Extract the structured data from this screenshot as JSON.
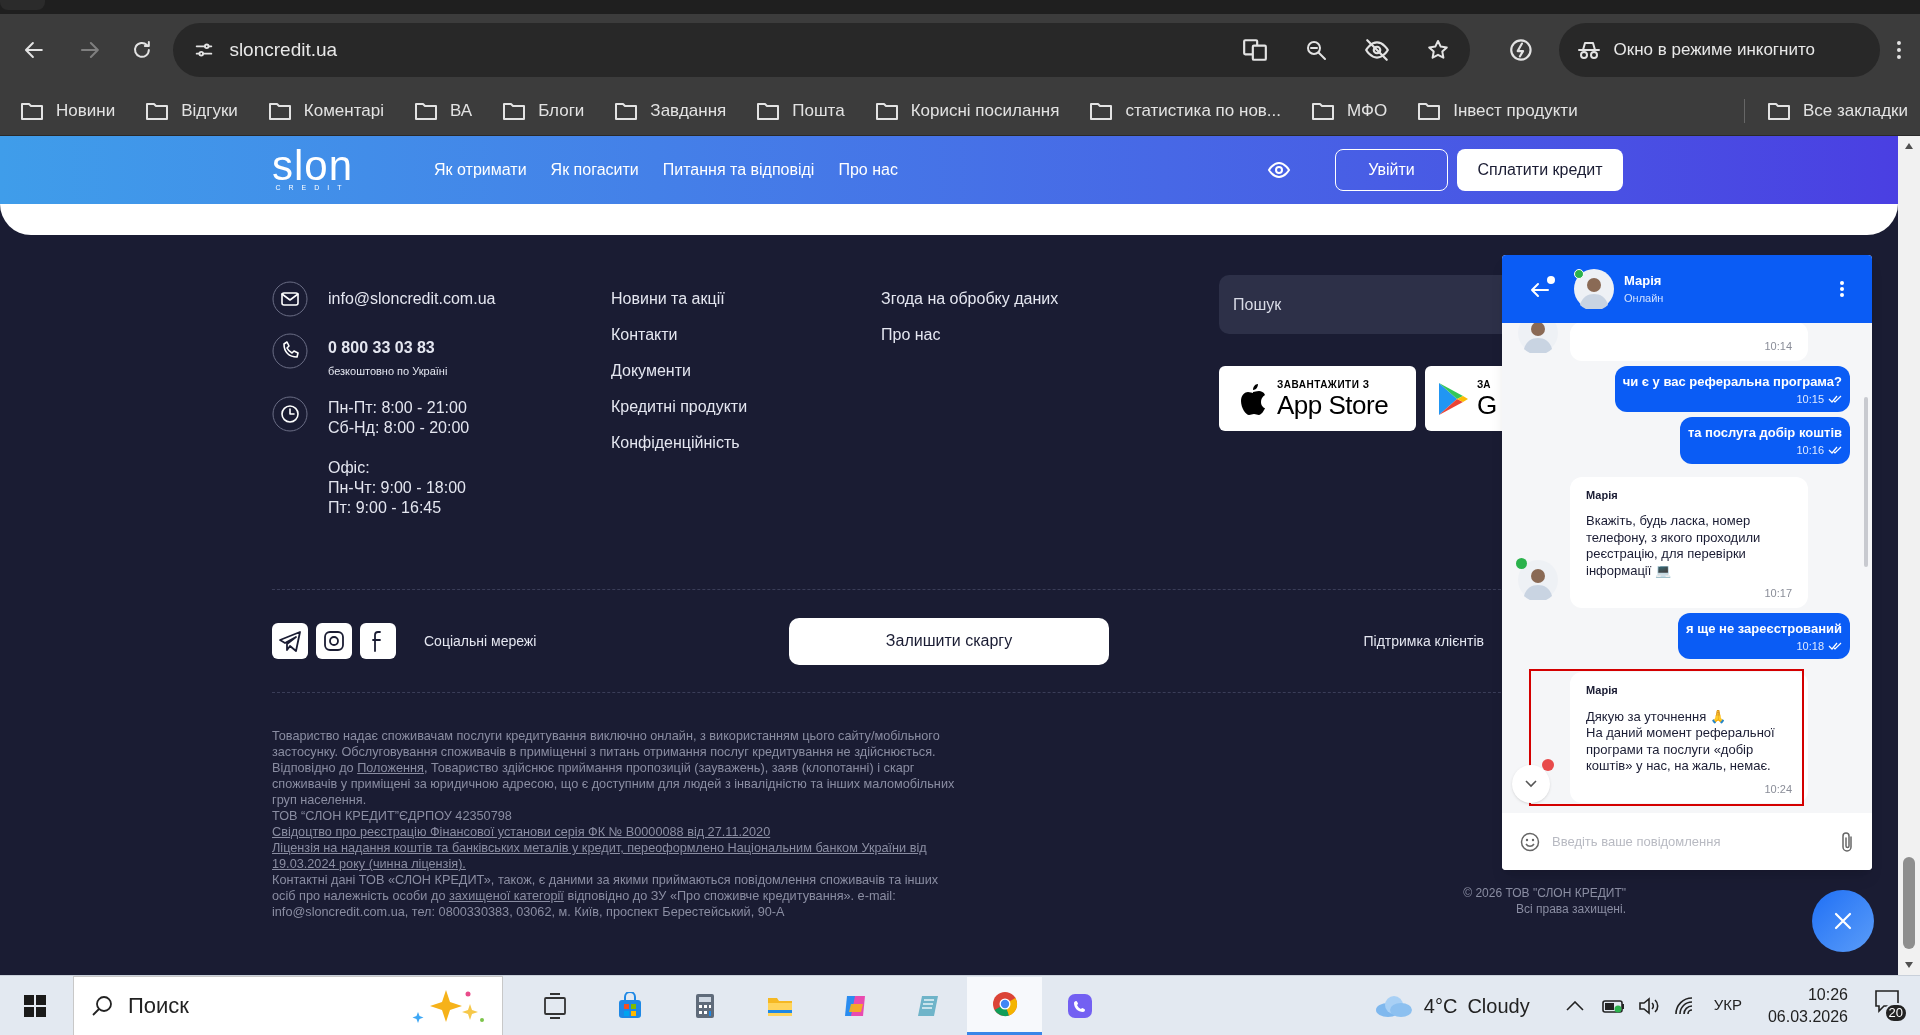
{
  "browser": {
    "back_enabled": true,
    "forward_enabled": false,
    "url": "sloncredit.ua",
    "incognito_label": "Окно в режиме инкогнито",
    "bookmarks": [
      "Новини",
      "Відгуки",
      "Коментарі",
      "ВА",
      "Блоги",
      "Завдання",
      "Пошта",
      "Корисні посилання",
      "статистика по нов...",
      "МФО",
      "Інвест продукти"
    ],
    "all_bookmarks": "Все закладки"
  },
  "site_header": {
    "logo": {
      "main": "slon",
      "sub": "CREDIT"
    },
    "nav": [
      "Як отримати",
      "Як погасити",
      "Питання та відповіді",
      "Про нас"
    ],
    "login": "Увійти",
    "pay": "Сплатити кредит"
  },
  "footer": {
    "contacts": {
      "email": "info@sloncredit.com.ua",
      "phone": "0 800 33 03 83",
      "phone_note": "безкоштовно по Україні",
      "hours": [
        "Пн-Пт: 8:00 - 21:00",
        "Сб-Нд: 8:00 - 20:00"
      ],
      "office": [
        "Офіс:",
        "Пн-Чт: 9:00 - 18:00",
        "Пт: 9:00 - 16:45"
      ]
    },
    "links_1": [
      "Новини та акції",
      "Контакти",
      "Документи",
      "Кредитні продукти",
      "Конфіденційність"
    ],
    "links_2": [
      "Згода на обробку даних",
      "Про нас"
    ],
    "search": {
      "placeholder": "Пошук"
    },
    "app_store": {
      "caption": "ЗАВАНТАЖИТИ З",
      "name": "App Store"
    },
    "google_play": {
      "caption": "ЗА",
      "name": "G"
    },
    "social_label": "Соціальні мережі",
    "complaint_button": "Залишити скаргу",
    "support_label": "Підтримка клієнтів",
    "legal_lines": [
      [
        {
          "text": "Товариство надає споживачам послуги кредитування виключно онлайн, з використанням цього сайту/мобільного",
          "link": false
        }
      ],
      [
        {
          "text": "застосунку. Обслуговування споживачів в приміщенні з питань отримання послуг кредитування не здійснюється.",
          "link": false
        }
      ],
      [
        {
          "text": "Відповідно до ",
          "link": false
        },
        {
          "text": "Положення",
          "link": true
        },
        {
          "text": ", Товариство здійснює приймання пропозицій (зауважень), заяв (клопотанні) і скарг",
          "link": false
        }
      ],
      [
        {
          "text": "споживачів у приміщені за юридичною адресою, що є доступним для людей з інвалідністю та інших маломобільних",
          "link": false
        }
      ],
      [
        {
          "text": "груп населення.",
          "link": false
        }
      ],
      [
        {
          "text": "ТОВ “СЛОН КРЕДИТ”ЄДРПОУ 42350798",
          "link": false
        }
      ],
      [
        {
          "text": "Свідоцтво про реєстрацію Фінансової установи серія ФК № В0000088 від 27.11.2020",
          "link": true
        }
      ],
      [
        {
          "text": "Ліцензія на надання коштів та банківських металів у кредит, переоформлено Національним банком України від",
          "link": true
        }
      ],
      [
        {
          "text": "19.03.2024 року (чинна ліцензія).",
          "link": true
        }
      ],
      [
        {
          "text": "Контактні дані ТОВ «СЛОН КРЕДИТ», також, є даними за якими приймаються повідомлення споживачів та інших",
          "link": false
        }
      ],
      [
        {
          "text": "осіб про належність особи до ",
          "link": false
        },
        {
          "text": "захищеної категорії",
          "link": true
        },
        {
          "text": " відповідно до ЗУ «Про споживче кредитування». e-mail:",
          "link": false
        }
      ],
      [
        {
          "text": "info@sloncredit.com.ua, тел: 0800330383, 03062, м. Київ, проспект Берестейський, 90-А",
          "link": false
        }
      ]
    ],
    "copyright": [
      "© 2026 ТОВ \"СЛОН КРЕДИТ\"",
      "Всі права захищені."
    ]
  },
  "chat": {
    "agent": {
      "name": "Марія",
      "status": "Онлайн",
      "online": true
    },
    "messages": [
      {
        "kind": "operator",
        "time": "10:14",
        "avatar": true,
        "online": false,
        "highlighted": false
      },
      {
        "kind": "user",
        "text": "чи є у вас реферальна програма?",
        "time": "10:15",
        "read": true
      },
      {
        "kind": "user",
        "text": "та послуга добір коштів",
        "time": "10:16",
        "read": true
      },
      {
        "kind": "operator",
        "author": "Марія",
        "text": "Вкажіть, будь ласка, номер телефону, з якого проходили реєстрацію, для перевірки інформації 💻",
        "time": "10:17",
        "avatar": true,
        "online": true,
        "highlighted": false
      },
      {
        "kind": "user",
        "text": "я ще не зареєстрований",
        "time": "10:18",
        "read": true
      },
      {
        "kind": "operator",
        "author": "Марія",
        "text": "Дякую за уточнення 🙏\nНа даний момент реферальної програми та послуги «добір коштів» у нас, на жаль, немає.",
        "time": "10:24",
        "avatar": false,
        "highlighted": true
      }
    ],
    "unread": true,
    "input": {
      "placeholder": "Введіть ваше повідомлення"
    }
  },
  "taskbar": {
    "search": "Поиск",
    "apps": [
      {
        "kind": "taskview",
        "selected": false
      },
      {
        "kind": "store",
        "selected": false
      },
      {
        "kind": "calculator",
        "selected": false
      },
      {
        "kind": "explorer",
        "selected": false
      },
      {
        "kind": "copilot",
        "selected": false
      },
      {
        "kind": "notes",
        "selected": false
      },
      {
        "kind": "chrome",
        "selected": true
      },
      {
        "kind": "viber",
        "selected": false
      }
    ],
    "weather": {
      "temp": "4°C",
      "text": "Cloudy"
    },
    "language": "УКР",
    "time": "10:26",
    "date": "06.03.2026",
    "notifications": "20"
  }
}
